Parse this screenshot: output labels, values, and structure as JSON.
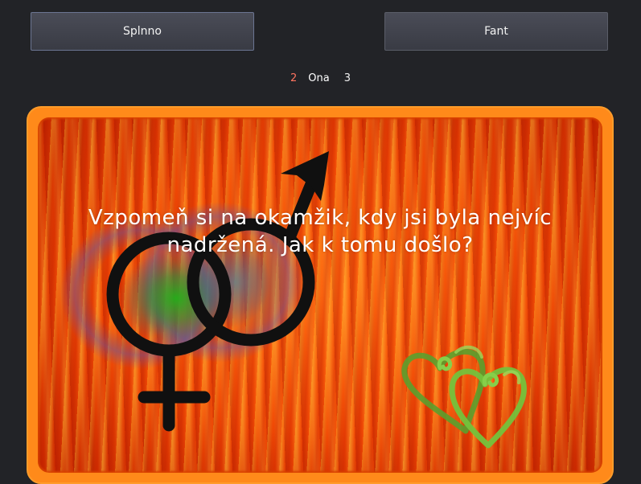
{
  "buttons": {
    "left_label": "Splnno",
    "right_label": "Fant"
  },
  "navigation": {
    "previous": "2",
    "current": "Ona",
    "next": "3"
  },
  "card": {
    "question": "Vzpomeň si na okamžik, kdy jsi byla nejvíc nadržená. Jak k tomu došlo?"
  },
  "icons": {
    "gender_symbols": "venus-mars-symbols-icon",
    "hearts": "green-hearts-icon"
  },
  "colors": {
    "background": "#222327",
    "card_border": "#ff8a1a",
    "previous_number": "#ff7460",
    "hearts": "#6fbf3a",
    "symbols": "#101010"
  }
}
